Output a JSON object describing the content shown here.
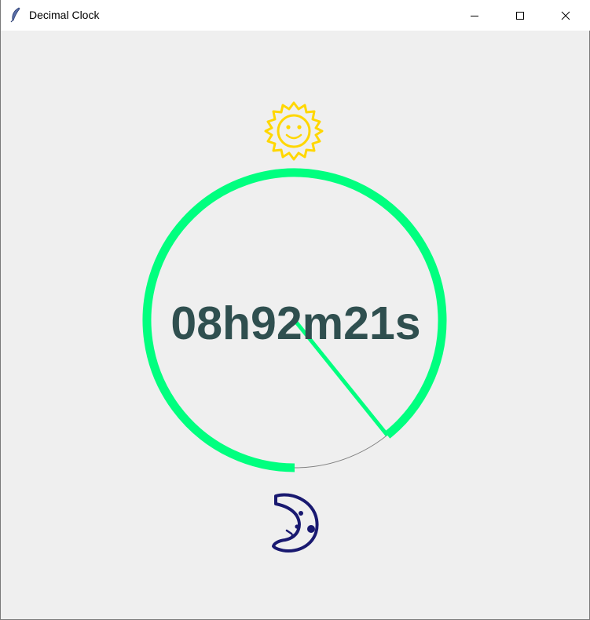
{
  "window": {
    "title": "Decimal Clock",
    "app_icon": "feather-icon",
    "controls": [
      "minimize-icon",
      "maximize-icon",
      "close-icon"
    ]
  },
  "clock": {
    "time_text": "08h92m21s",
    "day_fraction": 0.8921,
    "day_icon": "sun-face-icon",
    "night_icon": "crescent-moon-face-icon",
    "colors": {
      "background": "#efefef",
      "arc": "#00ff7f",
      "track": "#808080",
      "text": "#2f4f4f",
      "sun": "#ffd700",
      "moon": "#191970"
    }
  }
}
